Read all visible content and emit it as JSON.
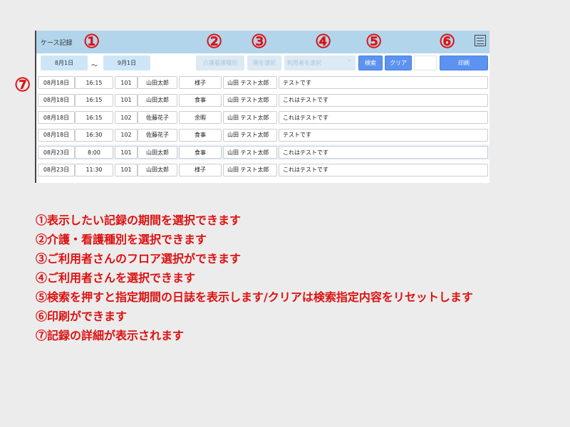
{
  "screen": {
    "title": "ケース記録",
    "filters": {
      "date_from": "8月1日",
      "separator": "〜",
      "date_to": "9月1日",
      "care_type_placeholder": "介護看護種別",
      "floor_placeholder": "階を選択",
      "user_placeholder": "利用者を選択",
      "search_label": "検索",
      "clear_label": "クリア",
      "print_label": "印刷"
    },
    "rows": [
      {
        "date": "08月18日",
        "time": "16:15",
        "room": "101",
        "name": "山田太郎",
        "type": "様子",
        "staff": "山田 テスト太郎",
        "text": "テストです"
      },
      {
        "date": "08月18日",
        "time": "16:15",
        "room": "101",
        "name": "山田太郎",
        "type": "食事",
        "staff": "山田 テスト太郎",
        "text": "これはテストです"
      },
      {
        "date": "08月18日",
        "time": "16:15",
        "room": "102",
        "name": "佐藤花子",
        "type": "余暇",
        "staff": "山田 テスト太郎",
        "text": "これはテストです"
      },
      {
        "date": "08月18日",
        "time": "16:30",
        "room": "102",
        "name": "佐藤花子",
        "type": "食事",
        "staff": "山田 テスト太郎",
        "text": "テストです"
      },
      {
        "date": "08月23日",
        "time": "8:00",
        "room": "101",
        "name": "山田太郎",
        "type": "食事",
        "staff": "山田 テスト太郎",
        "text": "これはテストです"
      },
      {
        "date": "08月23日",
        "time": "11:30",
        "room": "101",
        "name": "山田太郎",
        "type": "様子",
        "staff": "山田 テスト太郎",
        "text": "これはテストです"
      }
    ]
  },
  "markers": [
    "①",
    "②",
    "③",
    "④",
    "⑤",
    "⑥",
    "⑦"
  ],
  "legend": [
    "①表示したい記録の期間を選択できます",
    "②介護・看護種別を選択できます",
    "③ご利用者さんのフロア選択ができます",
    "④ご利用者さんを選択できます",
    "⑤検索を押すと指定期間の日誌を表示します/クリアは検索指定内容をリセットします",
    "⑥印刷ができます",
    "⑦記録の詳細が表示されます"
  ],
  "colors": {
    "accent_red": "#dd1111",
    "header_blue": "#b3d5ec",
    "button_blue": "#5d93f0"
  }
}
